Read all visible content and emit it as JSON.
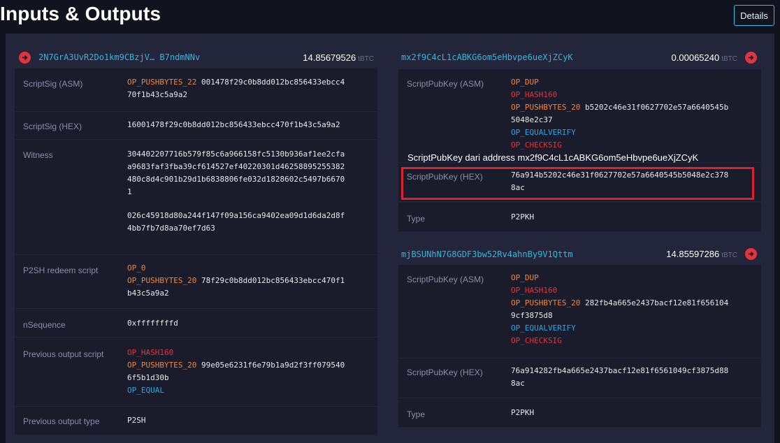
{
  "header": {
    "title": "Inputs & Outputs",
    "details_label": "Details"
  },
  "unit": "tBTC",
  "input": {
    "address": "2N7GrA3UvR2Do1km9CBzjV… B7ndmNNv",
    "amount": "14.85679526",
    "rows": {
      "scriptsig_asm": {
        "label": "ScriptSig (ASM)",
        "op": "OP_PUSHBYTES_22",
        "line1": "001478f29c0b8dd012bc856433ebcc4",
        "line2": "70f1b43c5a9a2"
      },
      "scriptsig_hex": {
        "label": "ScriptSig (HEX)",
        "value": "16001478f29c0b8dd012bc856433ebcc470f1b43c5a9a2"
      },
      "witness": {
        "label": "Witness",
        "lines": [
          "304402207716b579f85c6a966158fc5130b936af1ee2cfa",
          "a9683faf3fba39cf614527ef40220301d46258895255382",
          "480c8d4c901b29d1b6838806fe032d1828602c5497b6670",
          "1",
          "026c45918d80a244f147f09a156ca9402ea09d1d6da2d8f",
          "4bb7fb7d8aa70ef7d63"
        ]
      },
      "p2sh_redeem": {
        "label": "P2SH redeem script",
        "op0": "OP_0",
        "op1": "OP_PUSHBYTES_20",
        "line1": "78f29c0b8dd012bc856433ebcc470f1",
        "line2": "b43c5a9a2"
      },
      "nsequence": {
        "label": "nSequence",
        "value": "0xffffffffd"
      },
      "prev_script": {
        "label": "Previous output script",
        "op0": "OP_HASH160",
        "op1": "OP_PUSHBYTES_20",
        "line1": "99e05e6231f6e79b1a9d2f3ff079540",
        "line2": "6f5b1d30b",
        "op2": "OP_EQUAL"
      },
      "prev_type": {
        "label": "Previous output type",
        "value": "P2SH"
      }
    }
  },
  "outputs": [
    {
      "address": "mx2f9C4cL1cABKG6om5eHbvpe6ueXjZCyK",
      "amount": "0.00065240",
      "asm": {
        "label": "ScriptPubKey (ASM)",
        "op0": "OP_DUP",
        "op1": "OP_HASH160",
        "op2": "OP_PUSHBYTES_20",
        "line1": "b5202c46e31f0627702e57a6640545b",
        "line2": "5048e2c37",
        "op3": "OP_EQUALVERIFY",
        "op4": "OP_CHECKSIG"
      },
      "hex": {
        "label": "ScriptPubKey (HEX)",
        "line1": "76a914b5202c46e31f0627702e57a6640545b5048e2c378",
        "line2": "8ac"
      },
      "type": {
        "label": "Type",
        "value": "P2PKH"
      }
    },
    {
      "address": "mjBSUNhN7G8GDF3bw52Rv4ahnBy9V1Qttm",
      "amount": "14.85597286",
      "asm": {
        "label": "ScriptPubKey (ASM)",
        "op0": "OP_DUP",
        "op1": "OP_HASH160",
        "op2": "OP_PUSHBYTES_20",
        "line1": "282fb4a665e2437bacf12e81f656104",
        "line2": "9cf3875d8",
        "op3": "OP_EQUALVERIFY",
        "op4": "OP_CHECKSIG"
      },
      "hex": {
        "label": "ScriptPubKey (HEX)",
        "line1": "76a914282fb4a665e2437bacf12e81f6561049cf3875d88",
        "line2": "8ac"
      },
      "type": {
        "label": "Type",
        "value": "P2PKH"
      }
    }
  ],
  "annotation": {
    "text": "ScriptPubKey dari address mx2f9C4cL1cABKG6om5eHbvpe6ueXjZCyK",
    "color": "#d9232f"
  },
  "colors": {
    "accent": "#2fb8e0",
    "op_orange": "#f0843b",
    "op_red": "#e0343f",
    "op_blue": "#2fa4e0"
  }
}
